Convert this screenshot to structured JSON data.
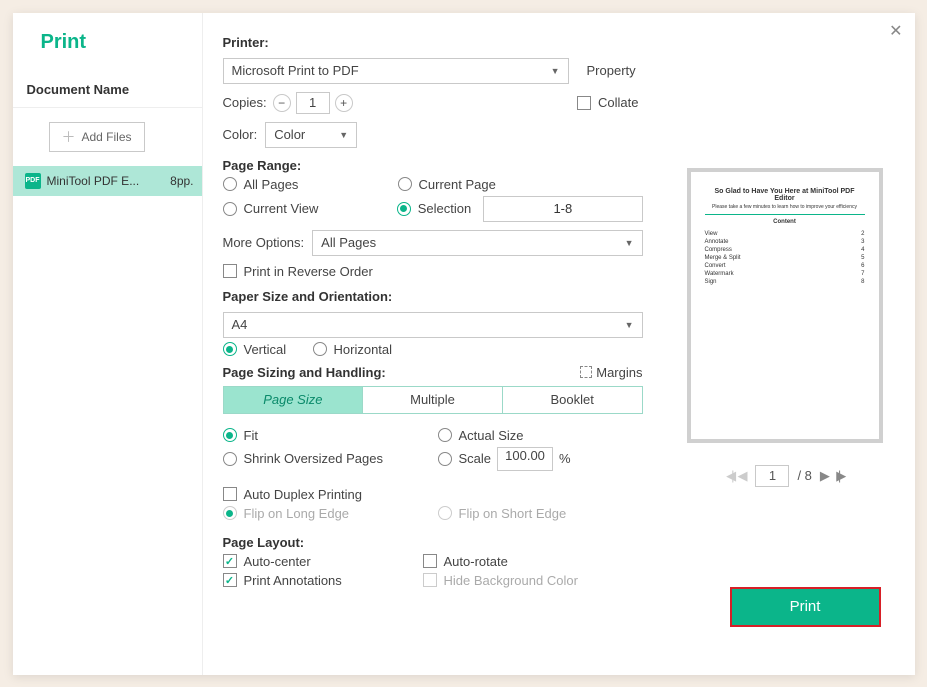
{
  "title": "Print",
  "doc_name_header": "Document Name",
  "left": {
    "add_files": "Add Files",
    "file_name": "MiniTool PDF E...",
    "file_pages": "8pp."
  },
  "printer": {
    "label": "Printer:",
    "value": "Microsoft Print to PDF",
    "property": "Property"
  },
  "copies": {
    "label": "Copies:",
    "value": "1",
    "collate": "Collate"
  },
  "color": {
    "label": "Color:",
    "value": "Color"
  },
  "range": {
    "label": "Page Range:",
    "all": "All Pages",
    "current_page": "Current Page",
    "current_view": "Current View",
    "selection": "Selection",
    "selection_value": "1-8",
    "more_options": "More Options:",
    "more_value": "All Pages",
    "reverse": "Print in Reverse Order"
  },
  "paper": {
    "label": "Paper Size and Orientation:",
    "size": "A4",
    "vertical": "Vertical",
    "horizontal": "Horizontal"
  },
  "sizing": {
    "label": "Page Sizing and Handling:",
    "margins": "Margins",
    "tabs": {
      "size": "Page Size",
      "multi": "Multiple",
      "book": "Booklet"
    },
    "fit": "Fit",
    "actual": "Actual Size",
    "shrink": "Shrink Oversized Pages",
    "scale": "Scale",
    "scale_value": "100.00",
    "percent": "%"
  },
  "duplex": {
    "auto": "Auto Duplex Printing",
    "long": "Flip on Long Edge",
    "short": "Flip on Short Edge"
  },
  "layout": {
    "label": "Page Layout:",
    "auto_center": "Auto-center",
    "auto_rotate": "Auto-rotate",
    "annotations": "Print Annotations",
    "hide_bg": "Hide Background Color"
  },
  "preview": {
    "title": "So Glad to Have You Here at MiniTool PDF Editor",
    "sub": "Please take a few minutes to learn how to improve your efficiency",
    "section": "Content",
    "rows": [
      "View",
      "Annotate",
      "Compress",
      "Merge & Split",
      "Convert",
      "Watermark",
      "Sign"
    ]
  },
  "pager": {
    "page": "1",
    "total": "/ 8"
  },
  "print_btn": "Print"
}
